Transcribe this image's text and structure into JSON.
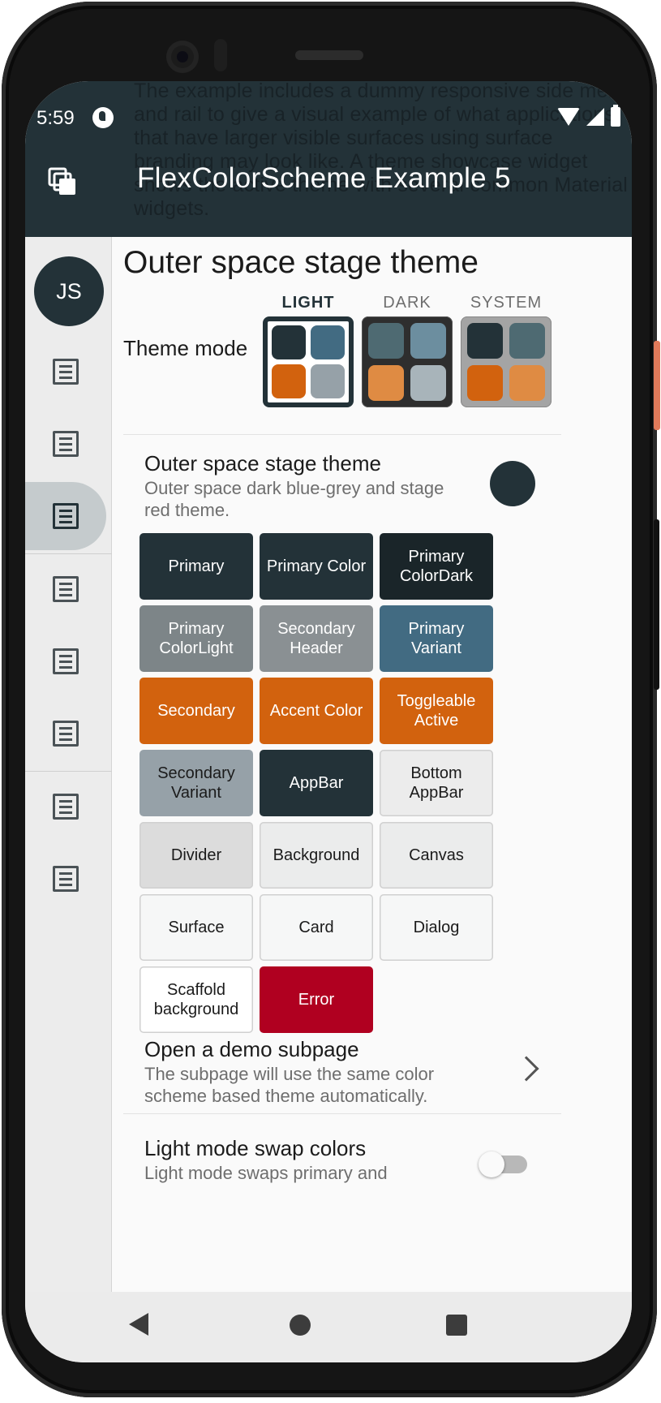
{
  "status_bar": {
    "time": "5:59"
  },
  "app_bar": {
    "title": "FlexColorScheme Example 5",
    "background_text": "The example includes a dummy responsive side menu and rail to give a visual example of what applications that have larger visible surfaces using surface branding may look like. A theme showcase widget shows the active theme with several common Material widgets."
  },
  "rail": {
    "avatar_initials": "JS",
    "selected_index": 2,
    "item_count": 8
  },
  "page": {
    "title": "Outer space stage theme"
  },
  "theme_mode": {
    "label": "Theme mode",
    "options": [
      {
        "label": "LIGHT",
        "active": true,
        "swatches": [
          "#233238",
          "#426b82",
          "#d2620e",
          "#96a1a8"
        ]
      },
      {
        "label": "DARK",
        "active": false,
        "swatches": [
          "#4e6a72",
          "#6c8e9f",
          "#df8b43",
          "#a8b4ba"
        ]
      },
      {
        "label": "SYSTEM",
        "active": false,
        "swatches": [
          "#233238",
          "#4e6a72",
          "#d2620e",
          "#df8b43"
        ]
      }
    ]
  },
  "theme_info": {
    "name": "Outer space stage theme",
    "description": "Outer space dark blue-grey and stage red theme.",
    "color": "#233238"
  },
  "color_cells": [
    {
      "label": "Primary",
      "bg": "#233238",
      "fg": "#ffffff"
    },
    {
      "label": "Primary Color",
      "bg": "#233238",
      "fg": "#ffffff"
    },
    {
      "label": "Primary ColorDark",
      "bg": "#1a2529",
      "fg": "#ffffff"
    },
    {
      "label": "Primary ColorLight",
      "bg": "#7d8588",
      "fg": "#ffffff"
    },
    {
      "label": "Secondary Header",
      "bg": "#8a9093",
      "fg": "#ffffff"
    },
    {
      "label": "Primary Variant",
      "bg": "#426b82",
      "fg": "#ffffff"
    },
    {
      "label": "Secondary",
      "bg": "#d2620e",
      "fg": "#ffffff"
    },
    {
      "label": "Accent Color",
      "bg": "#d2620e",
      "fg": "#ffffff"
    },
    {
      "label": "Toggleable Active",
      "bg": "#d2620e",
      "fg": "#ffffff"
    },
    {
      "label": "Secondary Variant",
      "bg": "#96a1a8",
      "fg": "#1b1b1b"
    },
    {
      "label": "AppBar",
      "bg": "#233238",
      "fg": "#ffffff"
    },
    {
      "label": "Bottom AppBar",
      "bg": "#ececec",
      "fg": "#1b1b1b",
      "bordered": true
    },
    {
      "label": "Divider",
      "bg": "#dcdcdc",
      "fg": "#1b1b1b",
      "bordered": true
    },
    {
      "label": "Background",
      "bg": "#ebecec",
      "fg": "#1b1b1b",
      "bordered": true
    },
    {
      "label": "Canvas",
      "bg": "#ebecec",
      "fg": "#1b1b1b",
      "bordered": true
    },
    {
      "label": "Surface",
      "bg": "#f6f7f7",
      "fg": "#1b1b1b",
      "bordered": true
    },
    {
      "label": "Card",
      "bg": "#f6f7f7",
      "fg": "#1b1b1b",
      "bordered": true
    },
    {
      "label": "Dialog",
      "bg": "#f6f7f7",
      "fg": "#1b1b1b",
      "bordered": true
    },
    {
      "label": "Scaffold background",
      "bg": "#ffffff",
      "fg": "#1b1b1b",
      "bordered": true
    },
    {
      "label": "Error",
      "bg": "#b00020",
      "fg": "#ffffff"
    }
  ],
  "subpage": {
    "title": "Open a demo subpage",
    "subtitle": "The subpage will use the same color scheme based theme automatically."
  },
  "swap": {
    "title": "Light mode swap colors",
    "subtitle": "Light mode swaps primary and",
    "enabled": false
  }
}
